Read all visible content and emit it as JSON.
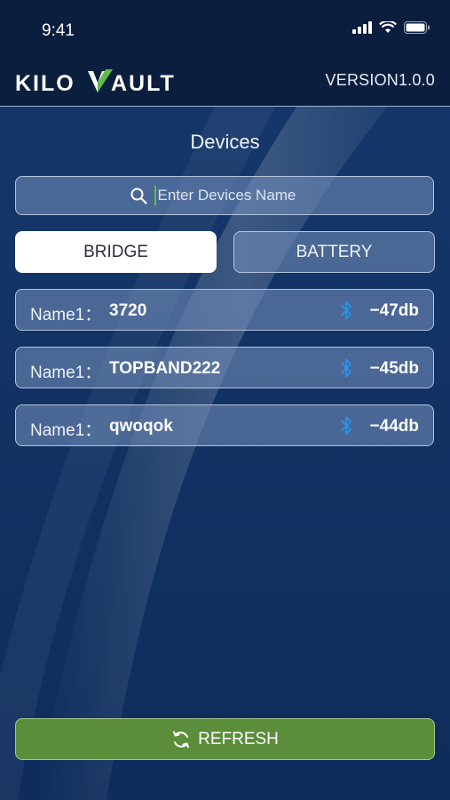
{
  "status_bar": {
    "time": "9:41"
  },
  "header": {
    "logo_text": "KILOVAULT",
    "version": "VERSION1.0.0"
  },
  "page": {
    "title": "Devices"
  },
  "search": {
    "placeholder": "Enter Devices Name",
    "icon": "search-icon"
  },
  "tabs": [
    {
      "label": "BRIDGE",
      "active": true
    },
    {
      "label": "BATTERY",
      "active": false
    }
  ],
  "devices": [
    {
      "label": "Name1：",
      "name": "3720",
      "rssi": "−47db",
      "icon": "bluetooth-icon"
    },
    {
      "label": "Name1：",
      "name": "TOPBAND222",
      "rssi": "−45db",
      "icon": "bluetooth-icon"
    },
    {
      "label": "Name1：",
      "name": "qwoqok",
      "rssi": "−44db",
      "icon": "bluetooth-icon"
    }
  ],
  "refresh": {
    "label": "REFRESH",
    "icon": "refresh-icon"
  },
  "colors": {
    "accent_green": "#5b8d3a",
    "header_bg": "#0b1e3e",
    "bluetooth_blue": "#2f8fe0"
  }
}
